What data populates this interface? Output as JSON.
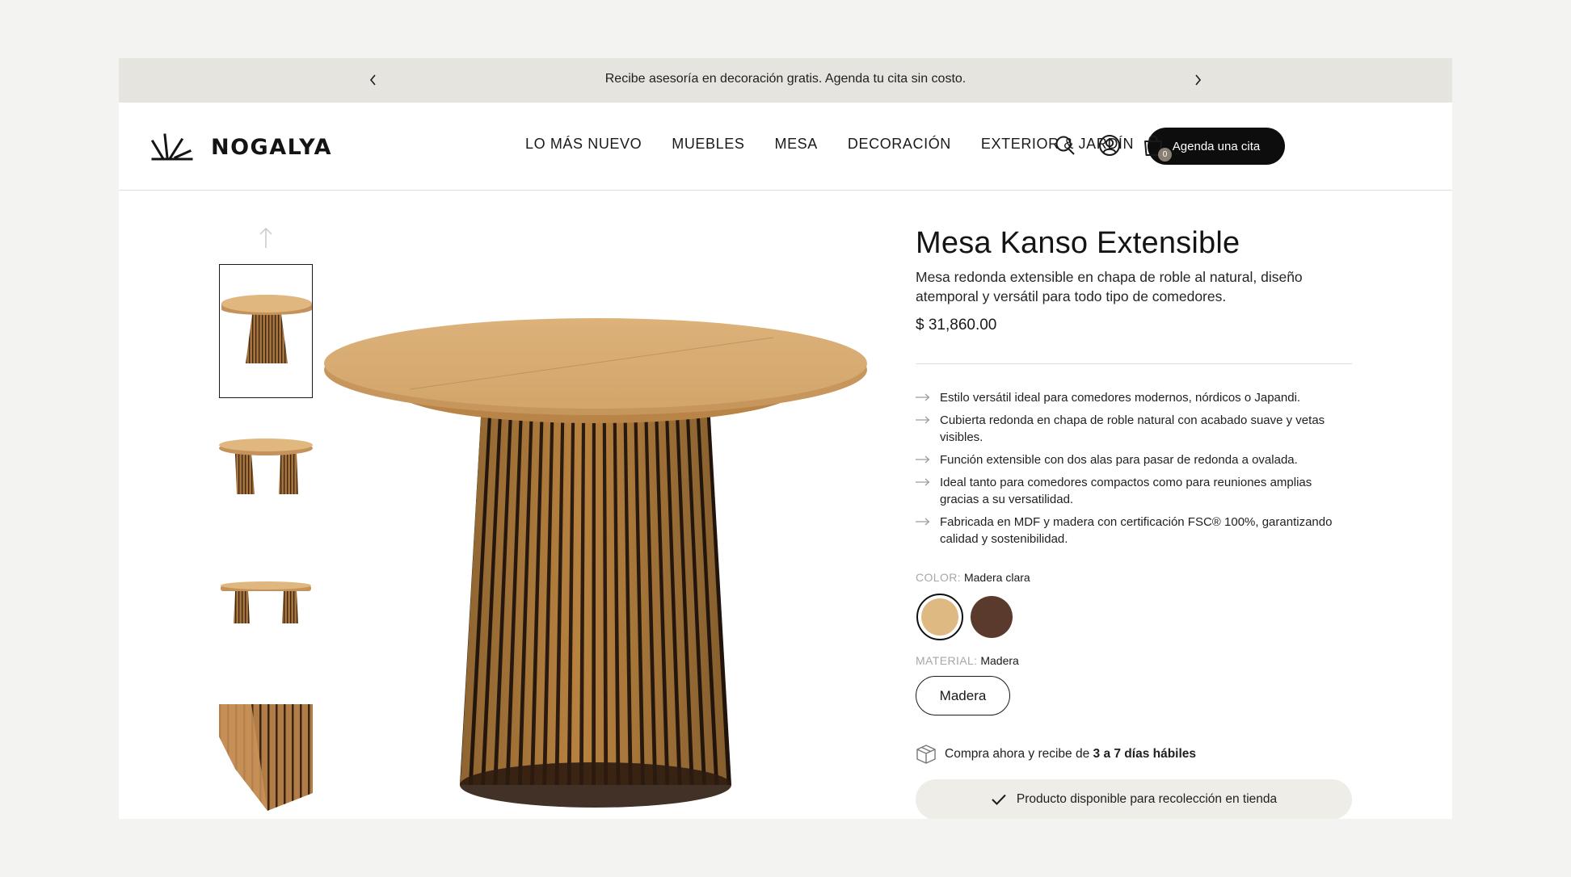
{
  "announcement": {
    "message": "Recibe asesoría en decoración gratis. Agenda tu cita sin costo."
  },
  "brand": {
    "name": "NOGALYA"
  },
  "nav": {
    "items": [
      "LO MÁS NUEVO",
      "MUEBLES",
      "MESA",
      "DECORACIÓN",
      "EXTERIOR & JARDÍN"
    ]
  },
  "header": {
    "cta_label": "Agenda una cita",
    "cart_count": "0",
    "icons": [
      "search-icon",
      "account-icon",
      "cart-icon"
    ]
  },
  "gallery": {
    "thumbnails": [
      "front-view",
      "extended-front-view",
      "extended-side-view",
      "base-detail"
    ],
    "active_index": 0
  },
  "product": {
    "title": "Mesa Kanso Extensible",
    "description": "Mesa redonda extensible en chapa de roble al natural, diseño atemporal y versátil para todo tipo de comedores.",
    "price": "$ 31,860.00",
    "features": [
      "Estilo versátil ideal para comedores modernos, nórdicos o Japandi.",
      "Cubierta redonda en chapa de roble natural con acabado suave y vetas visibles.",
      "Función extensible con dos alas para pasar de redonda a ovalada.",
      "Ideal tanto para comedores compactos como para reuniones amplias gracias a su versatilidad.",
      "Fabricada en MDF y madera con certificación FSC® 100%, garantizando calidad y sostenibilidad."
    ],
    "color": {
      "label": "COLOR:",
      "selected": "Madera clara",
      "swatches": [
        "#dfb982",
        "#5a3a2c"
      ]
    },
    "material": {
      "label": "MATERIAL:",
      "selected": "Madera",
      "options": [
        "Madera"
      ]
    },
    "shipping": {
      "prefix": "Compra ahora y recibe de ",
      "emphasis": "3 a 7 días hábiles"
    },
    "pickup": "Producto disponible para recolección en tienda"
  },
  "colors": {
    "announce_bg": "#e6e4df",
    "cta_bg": "#0d0d0d",
    "wood_light": "#dfb982",
    "wood_dark": "#5a3a2c"
  }
}
